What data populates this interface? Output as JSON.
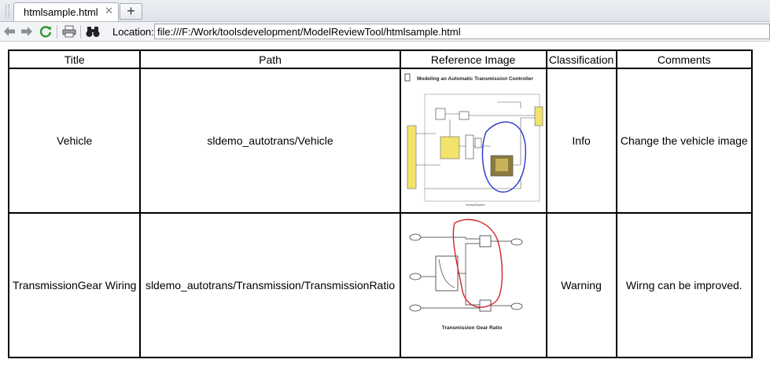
{
  "tab": {
    "title": "htmlsample.html",
    "close_glyph": "✕",
    "new_tab_glyph": "+"
  },
  "toolbar": {
    "icons": [
      "back-arrow-icon",
      "forward-arrow-icon",
      "refresh-icon",
      "print-icon",
      "find-binoculars-icon"
    ],
    "location_label": "Location:",
    "location_value": "file:///F:/Work/toolsdevelopment/ModelReviewTool/htmlsample.html"
  },
  "table": {
    "headers": [
      "Title",
      "Path",
      "Reference Image",
      "Classification",
      "Comments"
    ],
    "rows": [
      {
        "title": "Vehicle",
        "path": "sldemo_autotrans/Vehicle",
        "classification": "Info",
        "comments": "Change the vehicle image",
        "image_title": "Modeling an Automatic Transmission Controller",
        "highlight_color": "#2a35c8"
      },
      {
        "title": "TransmissionGear Wiring",
        "path": "sldemo_autotrans/Transmission/TransmissionRatio",
        "classification": "Warning",
        "comments": "Wirng can be improved.",
        "image_title": "Transmission Gear Ratio",
        "highlight_color": "#d0242a"
      }
    ]
  },
  "colors": {
    "refresh_green": "#2e9a2e",
    "accent_yellow": "#f2e36a"
  }
}
